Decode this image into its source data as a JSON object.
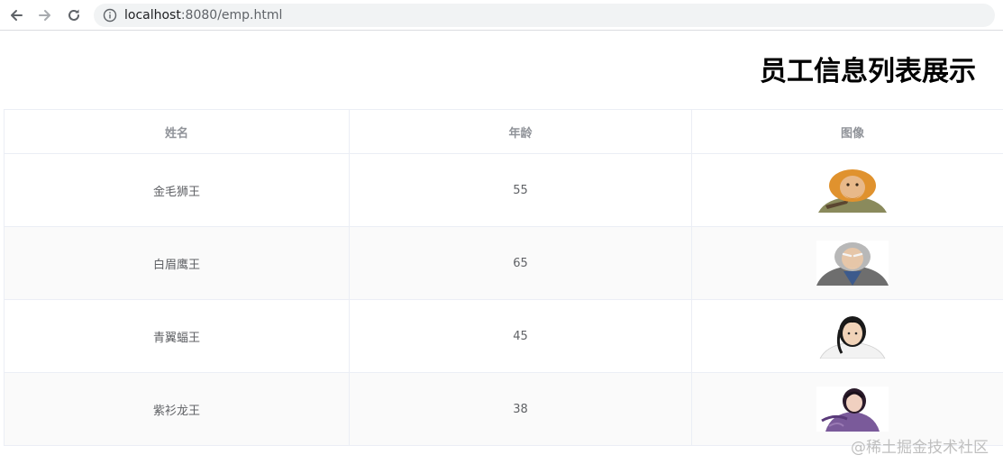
{
  "browser": {
    "url_host": "localhost",
    "url_rest": ":8080/emp.html",
    "icons": {
      "back": "arrow-left-icon",
      "forward": "arrow-right-icon",
      "reload": "reload-icon",
      "info": "info-icon"
    }
  },
  "page": {
    "title": "员工信息列表展示"
  },
  "table": {
    "headers": {
      "name": "姓名",
      "age": "年龄",
      "image": "图像"
    },
    "rows": [
      {
        "name": "金毛狮王",
        "age": "55",
        "avatar": "golden-lion-king"
      },
      {
        "name": "白眉鹰王",
        "age": "65",
        "avatar": "white-eyebrow-eagle-king"
      },
      {
        "name": "青翼蝠王",
        "age": "45",
        "avatar": "green-wing-bat-king"
      },
      {
        "name": "紫衫龙王",
        "age": "38",
        "avatar": "purple-robe-dragon-king"
      }
    ]
  },
  "watermark": "@稀土掘金技术社区",
  "colors": {
    "header_text": "#909399",
    "cell_text": "#606266",
    "border": "#ebeef5",
    "stripe": "#fafafa"
  }
}
